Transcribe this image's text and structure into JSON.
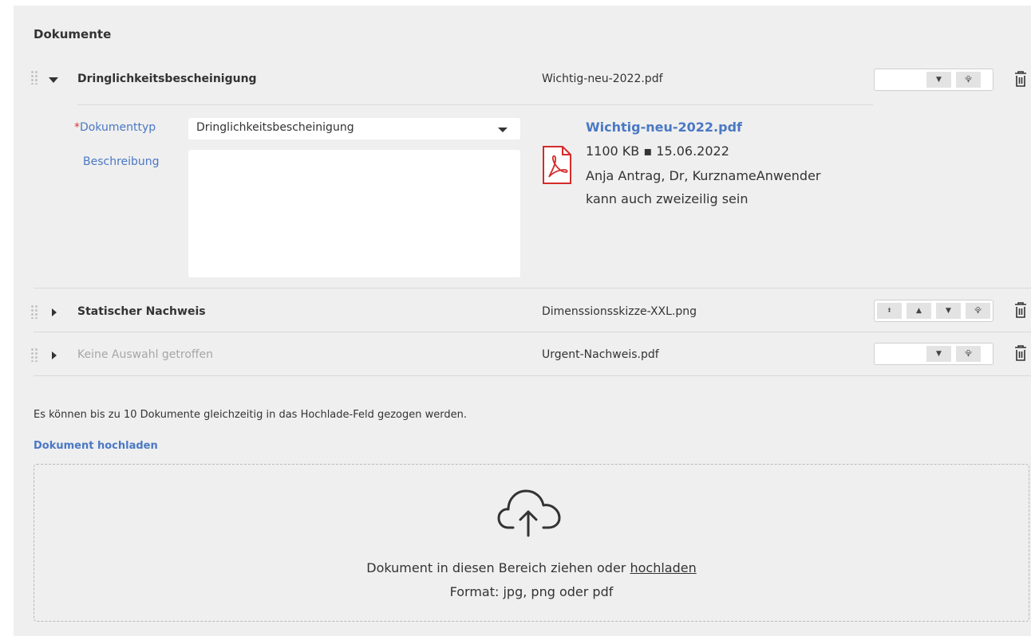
{
  "section": {
    "title": "Dokumente"
  },
  "documents": [
    {
      "type_label": "Dringlichkeitsbescheinigung",
      "file": "Wichtig-neu-2022.pdf",
      "expanded": true,
      "order_buttons": [
        "move-down",
        "move-bottom"
      ]
    },
    {
      "type_label": "Statischer Nachweis",
      "file": "Dimenssionsskizze-XXL.png",
      "expanded": false,
      "order_buttons": [
        "move-top",
        "move-up",
        "move-down",
        "move-bottom"
      ]
    },
    {
      "type_label": "Keine Auswahl getroffen",
      "file": "Urgent-Nachweis.pdf",
      "expanded": false,
      "muted": true,
      "order_buttons": [
        "move-down",
        "move-bottom"
      ]
    }
  ],
  "details": {
    "required_mark": "*",
    "doctype_label": "Dokumenttyp",
    "doctype_value": "Dringlichkeitsbescheinigung",
    "description_label": "Beschreibung",
    "description_value": "",
    "file_link": "Wichtig-neu-2022.pdf",
    "file_size_date": "1100 KB ▪ 15.06.2022",
    "file_author": "Anja Antrag, Dr, KurznameAnwender",
    "file_note": "kann auch zweizeilig sein"
  },
  "upload": {
    "info": "Es können bis zu 10 Dokumente gleichzeitig in das Hochlade-Feld gezogen werden.",
    "link": "Dokument hochladen",
    "drop_text": "Dokument in diesen Bereich ziehen oder",
    "drop_link": "hochladen",
    "format_text": "Format: jpg, png oder pdf"
  },
  "icons": {
    "glyphs": {
      "move-top": "⯒",
      "move-up": "▲",
      "move-down": "▼",
      "move-bottom": "⯓"
    },
    "pdf_color": "#d42b2b",
    "accent": "#4a78c4"
  }
}
